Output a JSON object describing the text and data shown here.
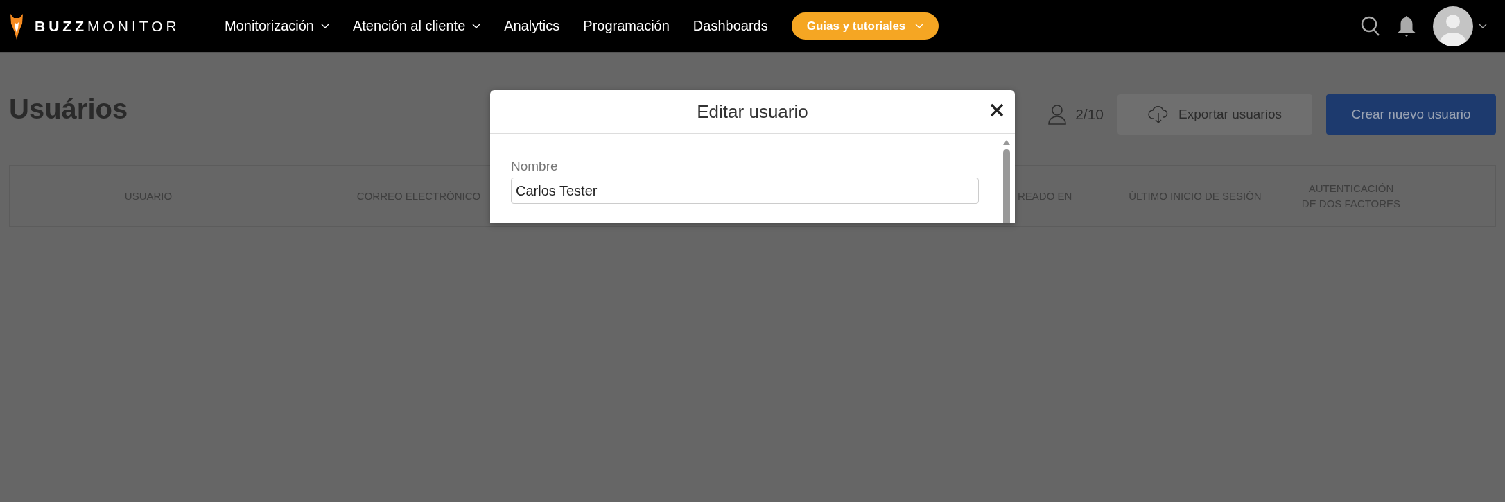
{
  "brand": {
    "logo_text": "**BUZZ**MONITOR"
  },
  "nav": [
    {
      "label": "Monitorización",
      "dropdown": true
    },
    {
      "label": "Atención al cliente",
      "dropdown": true
    },
    {
      "label": "Analytics",
      "dropdown": false
    },
    {
      "label": "Programación",
      "dropdown": false
    },
    {
      "label": "Dashboards",
      "dropdown": false
    }
  ],
  "guide_button": {
    "label": "Guias y tutoriales",
    "dropdown": true
  },
  "page": {
    "title": "Usuários",
    "user_count": "2/10",
    "export_button": "Exportar usuarios",
    "create_button": "Crear nuevo usuario"
  },
  "table": {
    "columns": [
      {
        "label": "USUARIO"
      },
      {
        "label": "CORREO ELECTRÓNICO"
      },
      {
        "label": "READO EN"
      },
      {
        "label": "ÚLTIMO INICIO DE SESIÓN"
      },
      {
        "label": "AUTENTICACIÓN\nDE DOS FACTORES"
      }
    ]
  },
  "modal": {
    "title": "Editar usuario",
    "fields": [
      {
        "label": "Nombre",
        "value": "Carlos Tester"
      }
    ]
  }
}
